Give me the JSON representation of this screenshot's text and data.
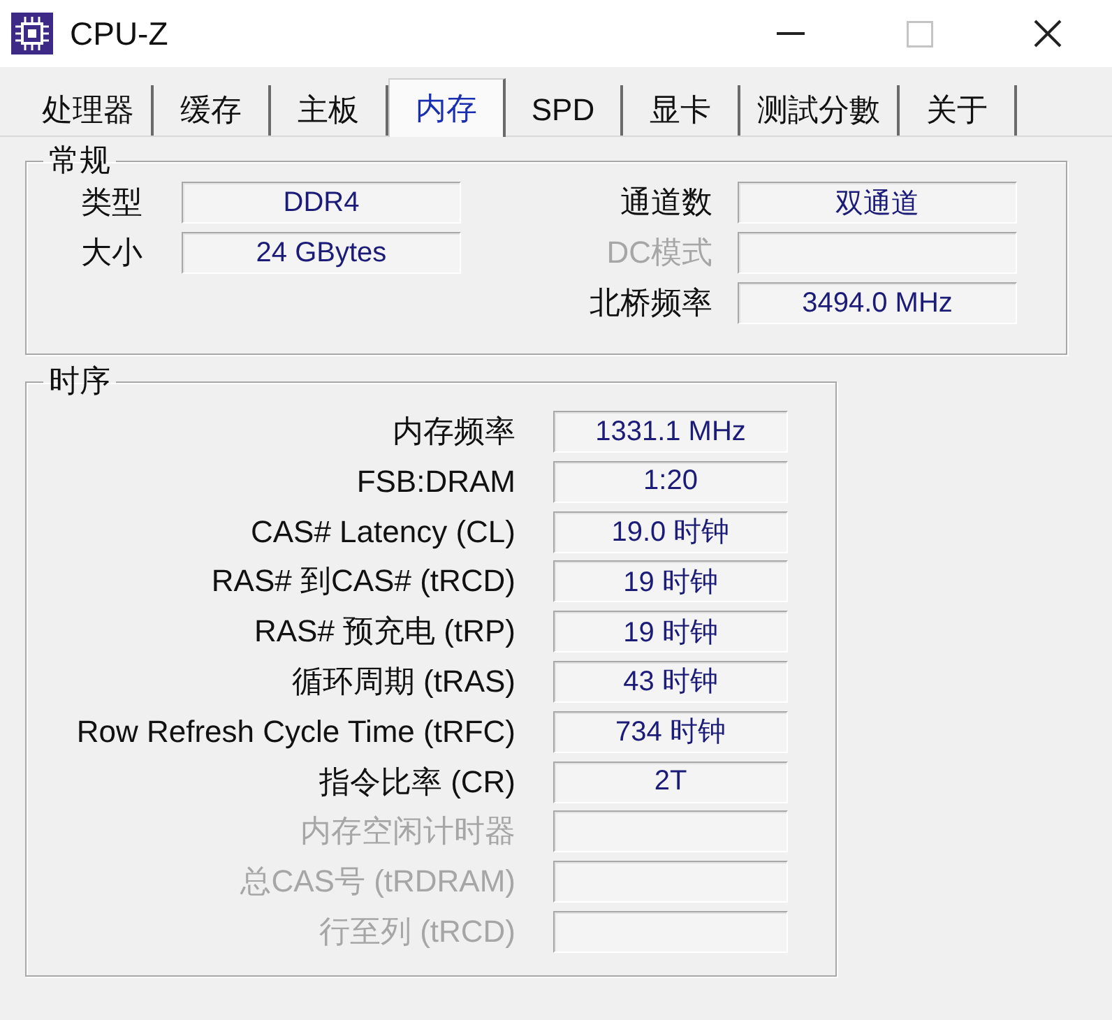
{
  "window": {
    "title": "CPU-Z",
    "controls": [
      {
        "kind": "minimize",
        "disabled": false
      },
      {
        "kind": "maximize",
        "disabled": true
      },
      {
        "kind": "close",
        "disabled": false
      }
    ]
  },
  "tabs": [
    {
      "label": "处理器",
      "selected": false
    },
    {
      "label": "缓存",
      "selected": false
    },
    {
      "label": "主板",
      "selected": false
    },
    {
      "label": "内存",
      "selected": true
    },
    {
      "label": "SPD",
      "selected": false
    },
    {
      "label": "显卡",
      "selected": false
    },
    {
      "label": "测試分數",
      "selected": false
    },
    {
      "label": "关于",
      "selected": false
    }
  ],
  "general": {
    "title": "常规",
    "left_fields": [
      {
        "label": "类型",
        "value": "DDR4",
        "disabled": false
      },
      {
        "label": "大小",
        "value": "24 GBytes",
        "disabled": false
      }
    ],
    "right_fields": [
      {
        "label": "通道数",
        "value": "双通道",
        "disabled": false
      },
      {
        "label": "DC模式",
        "disabled": true
      },
      {
        "label": "北桥频率",
        "value": "3494.0 MHz",
        "disabled": false
      }
    ]
  },
  "timings": {
    "title": "时序",
    "rows": [
      {
        "label": "内存频率",
        "value": "1331.1 MHz",
        "disabled": false
      },
      {
        "label": "FSB:DRAM",
        "value": "1:20",
        "disabled": false
      },
      {
        "label": "CAS# Latency (CL)",
        "value": "19.0 时钟",
        "disabled": false
      },
      {
        "label": "RAS# 到CAS# (tRCD)",
        "value": "19 时钟",
        "disabled": false
      },
      {
        "label": "RAS# 预充电 (tRP)",
        "value": "19 时钟",
        "disabled": false
      },
      {
        "label": "循环周期 (tRAS)",
        "value": "43 时钟",
        "disabled": false
      },
      {
        "label": "Row Refresh Cycle Time (tRFC)",
        "value": "734 时钟",
        "disabled": false
      },
      {
        "label": "指令比率 (CR)",
        "value": "2T",
        "disabled": false
      },
      {
        "label": "内存空闲计时器",
        "disabled": true
      },
      {
        "label": "总CAS号 (tRDRAM)",
        "disabled": true
      },
      {
        "label": "行至列 (tRCD)",
        "disabled": true
      }
    ]
  }
}
